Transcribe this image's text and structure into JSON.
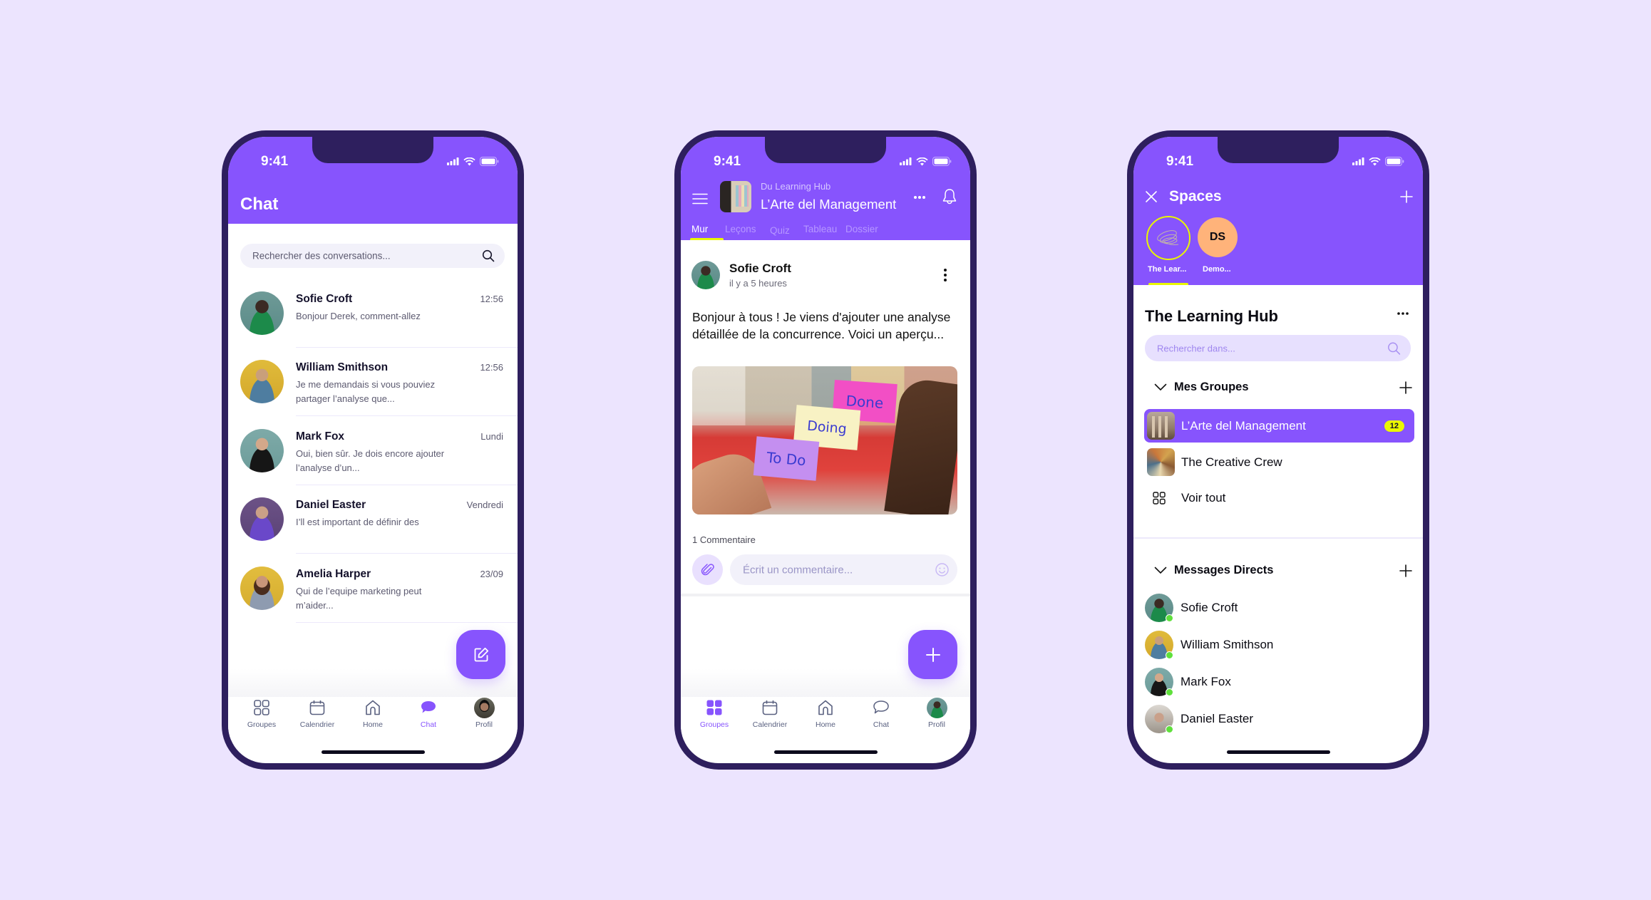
{
  "colors": {
    "background": "#ece4fe",
    "brand_purple": "#8754fd",
    "frame": "#2e1f5e",
    "accent_yellow": "#e9f700",
    "online_green": "#5fe03c"
  },
  "status_bar": {
    "time": "9:41",
    "icons": [
      "signal-icon",
      "wifi-icon",
      "battery-icon"
    ]
  },
  "tabbar": {
    "items": [
      {
        "label": "Groupes",
        "icon": "groups-grid-icon"
      },
      {
        "label": "Calendrier",
        "icon": "calendar-icon"
      },
      {
        "label": "Home",
        "icon": "home-icon"
      },
      {
        "label": "Chat",
        "icon": "chat-bubble-icon"
      },
      {
        "label": "Profil",
        "icon": "profile-avatar"
      }
    ]
  },
  "chat_screen": {
    "title": "Chat",
    "search_placeholder": "Rechercher des conversations...",
    "active_tab": "Chat",
    "conversations": [
      {
        "name": "Sofie Croft",
        "time": "12:56",
        "message": "Bonjour Derek, comment-allez"
      },
      {
        "name": "William Smithson",
        "time": "12:56",
        "message": "Je me demandais si vous pouviez partager l’analyse que..."
      },
      {
        "name": "Mark Fox",
        "time": "Lundi",
        "message": "Oui, bien sûr. Je dois encore ajouter l’analyse d’un..."
      },
      {
        "name": "Daniel Easter",
        "time": "Vendredi",
        "message": "I’ll est important de définir des"
      },
      {
        "name": "Amelia Harper",
        "time": "23/09",
        "message": "Qui de l’equipe marketing peut m’aider..."
      }
    ],
    "fab_icon": "compose-icon"
  },
  "course_screen": {
    "subtitle": "Du Learning Hub",
    "title": "L’Arte del Management",
    "tabs": [
      "Mur",
      "Leçons",
      "Quiz",
      "Tableau",
      "Dossier"
    ],
    "active_tab": "Mur",
    "post": {
      "author": "Sofie Croft",
      "time": "il y a 5 heures",
      "text": "Bonjour à tous ! Je viens d'ajouter une analyse détaillée de la concurrence. Voici un aperçu...",
      "image_notes": [
        "Done",
        "Doing",
        "To Do"
      ],
      "comment_count": "1 Commentaire",
      "comment_placeholder": "Écrit un commentaire..."
    },
    "fab_icon": "plus-icon",
    "active_tab_bar": "Groupes"
  },
  "spaces_screen": {
    "title": "Spaces",
    "spaces": [
      {
        "label": "The Lear...",
        "initials": ""
      },
      {
        "label": "Demo...",
        "initials": "DS"
      }
    ],
    "hub_title": "The Learning Hub",
    "search_placeholder": "Rechercher dans...",
    "groups_section": "Mes Groupes",
    "groups": [
      {
        "label": "L’Arte del Management",
        "badge": "12",
        "selected": true
      },
      {
        "label": "The Creative Crew",
        "badge": "",
        "selected": false
      }
    ],
    "see_all": "Voir tout",
    "dm_section": "Messages Directs",
    "direct_messages": [
      {
        "name": "Sofie Croft",
        "online": true
      },
      {
        "name": "William Smithson",
        "online": true
      },
      {
        "name": "Mark Fox",
        "online": true
      },
      {
        "name": "Daniel Easter",
        "online": true
      }
    ]
  }
}
